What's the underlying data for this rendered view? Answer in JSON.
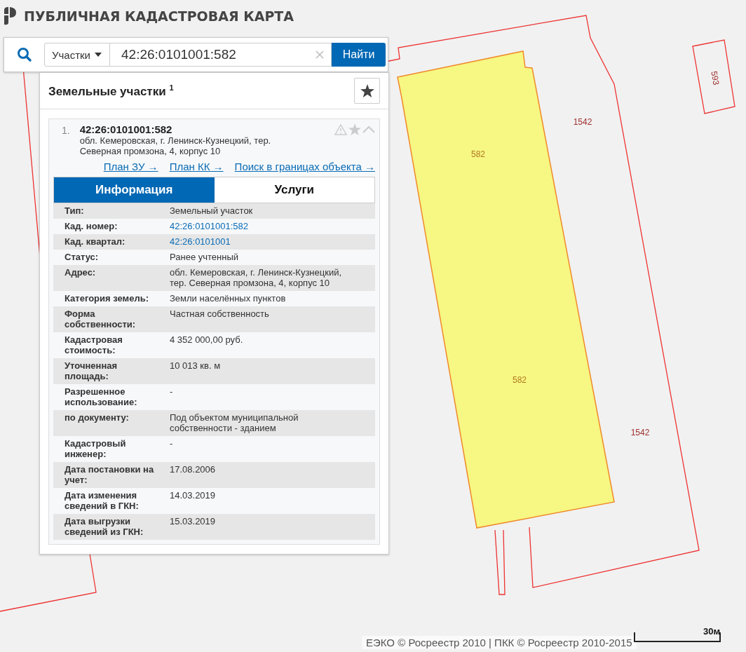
{
  "header": {
    "title": "ПУБЛИЧНАЯ КАДАСТРОВАЯ КАРТА"
  },
  "search": {
    "category": "Участки",
    "value": "42:26:0101001:582",
    "button": "Найти"
  },
  "results": {
    "title": "Земельные участки $^{1}$",
    "items": [
      {
        "index": "1.",
        "number": "42:26:0101001:582",
        "address": "обл. Кемеровская, г. Ленинск-Кузнецкий, тер. Северная промзона, 4, корпус 10",
        "links": [
          "План ЗУ →",
          "План КК →",
          "Поиск в границах объекта →"
        ],
        "tabs": [
          {
            "label": "Информация",
            "selected": true
          },
          {
            "label": "Услуги",
            "selected": false
          }
        ],
        "rows": [
          {
            "label": "Тип:",
            "value": "Земельный участок",
            "kind": "text"
          },
          {
            "label": "Кад. номер:",
            "value": "42:26:0101001:582",
            "kind": "link"
          },
          {
            "label": "Кад. квартал:",
            "value": "42:26:0101001",
            "kind": "link"
          },
          {
            "label": "Статус:",
            "value": "Ранее учтенный",
            "kind": "text"
          },
          {
            "label": "Адрес:",
            "value": "обл. Кемеровская, г. Ленинск-Кузнецкий, тер. Северная промзона, 4, корпус 10",
            "kind": "text"
          },
          {
            "label": "Категория земель:",
            "value": "Земли населённых пунктов",
            "kind": "text"
          },
          {
            "label": "Форма собственности:",
            "value": "Частная собственность",
            "kind": "text"
          },
          {
            "label": "Кадастровая стоимость:",
            "value": "4 352 000,00 руб.",
            "kind": "text"
          },
          {
            "label": "Уточненная площадь:",
            "value": "10 013 кв. м",
            "kind": "text"
          },
          {
            "label": "Разрешенное использование:",
            "value": "-",
            "kind": "text"
          },
          {
            "label": "по документу:",
            "value": "Под объектом муниципальной собственности - зданием",
            "kind": "text"
          },
          {
            "label": "Кадастровый инженер:",
            "value": "-",
            "kind": "text"
          },
          {
            "label": "Дата постановки на учет:",
            "value": "17.08.2006",
            "kind": "text"
          },
          {
            "label": "Дата изменения сведений в ГКН:",
            "value": "14.03.2019",
            "kind": "text"
          },
          {
            "label": "Дата выгрузки сведений из ГКН:",
            "value": "15.03.2019",
            "kind": "text"
          }
        ]
      }
    ]
  },
  "map": {
    "labels": [
      "593",
      "1542",
      "582",
      "582",
      "1542"
    ]
  },
  "footer": {
    "attribution": "ЕЭКО © Росреестр 2010 | ПКК © Росреестр 2010-2015",
    "scale": "30м"
  }
}
